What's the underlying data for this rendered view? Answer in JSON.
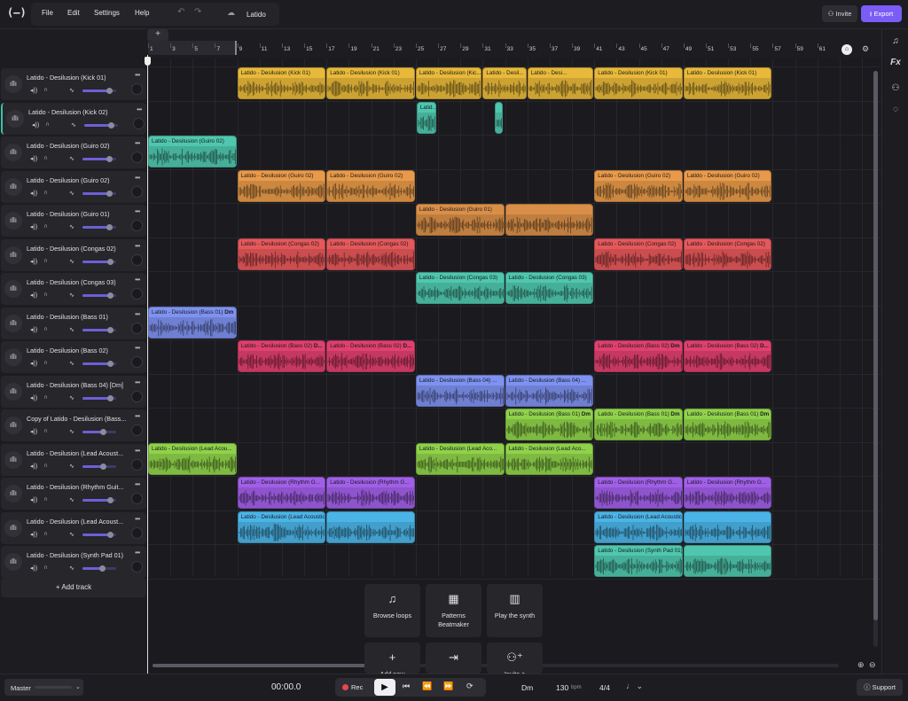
{
  "app": {
    "logo": "(—)",
    "project_name": "Latido"
  },
  "menu": {
    "items": [
      "File",
      "Edit",
      "Settings",
      "Help"
    ]
  },
  "header": {
    "invite_label": "Invite",
    "export_label": "Export"
  },
  "right_toolbar": {
    "icons": [
      "music-note-icon",
      "fx-icon",
      "users-icon",
      "chat-icon"
    ],
    "fx_label": "Fx"
  },
  "ruler": {
    "ticks": [
      "1",
      "3",
      "5",
      "7",
      "9",
      "11",
      "13",
      "15",
      "17",
      "19",
      "21",
      "23",
      "25",
      "27",
      "29",
      "31",
      "33",
      "35",
      "37",
      "39",
      "41",
      "43",
      "45",
      "47",
      "49",
      "51",
      "53",
      "55",
      "57",
      "59",
      "61"
    ]
  },
  "tracks": [
    {
      "name": "Latido - Desilusion (Kick 01)",
      "vol": 0.8
    },
    {
      "name": "Latido - Desilusion (Kick 02)",
      "vol": 0.8,
      "selected": true
    },
    {
      "name": "Latido - Desilusion (Guiro 02)",
      "vol": 0.78
    },
    {
      "name": "Latido - Desilusion (Guiro 02)",
      "vol": 0.78
    },
    {
      "name": "Latido - Desilusion (Guiro 01)",
      "vol": 0.78
    },
    {
      "name": "Latido - Desilusion (Congas 02)",
      "vol": 0.82
    },
    {
      "name": "Latido - Desilusion (Congas 03)",
      "vol": 0.82
    },
    {
      "name": "Latido - Desilusion (Bass 01)",
      "vol": 0.82
    },
    {
      "name": "Latido - Desilusion (Bass 02)",
      "vol": 0.82
    },
    {
      "name": "Latido - Desilusion (Bass 04) [Dm]",
      "vol": 0.82
    },
    {
      "name": "Copy of Latido - Desilusion (Bass...",
      "vol": 0.6
    },
    {
      "name": "Latido - Desilusion (Lead Acoust...",
      "vol": 0.6
    },
    {
      "name": "Latido - Desilusion (Rhythm Guit...",
      "vol": 0.82
    },
    {
      "name": "Latido - Desilusion (Lead Acoust...",
      "vol": 0.82
    },
    {
      "name": "Latido - Desilusion (Synth Pad 01)",
      "vol": 0.58
    }
  ],
  "track_controls": {
    "record_label": "R"
  },
  "add_track_label": "+ Add track",
  "clips": [
    {
      "row": 0,
      "label": "Latido - Desilusion (Kick 01)",
      "color": "#e8b93a"
    },
    {
      "row": 0,
      "label": "Latido - Desilusion (Kick 01)",
      "color": "#e8b93a"
    },
    {
      "row": 0,
      "label": "Latido - Desilusion (Kic...",
      "color": "#e8b93a"
    },
    {
      "row": 0,
      "label": "Latido - Desil...",
      "color": "#e8b93a"
    },
    {
      "row": 0,
      "label": "Latido - Desi...",
      "color": "#e8b93a"
    },
    {
      "row": 0,
      "label": "Latido - Desilusion (Kick 01)",
      "color": "#e8b93a"
    },
    {
      "row": 0,
      "label": "Latido - Desilusion (Kick 01)",
      "color": "#e8b93a"
    },
    {
      "row": 1,
      "label": "Latid...",
      "color": "#4fc7ae"
    },
    {
      "row": 1,
      "label": "",
      "color": "#4fc7ae"
    },
    {
      "row": 2,
      "label": "Latido - Desilusion (Guiro 02)",
      "color": "#4fc7ae"
    },
    {
      "row": 3,
      "label": "Latido - Desilusion (Guiro 02)",
      "color": "#e89a4a"
    },
    {
      "row": 3,
      "label": "Latido - Desilusion (Guiro 02)",
      "color": "#e89a4a"
    },
    {
      "row": 3,
      "label": "Latido - Desilusion (Guiro 02)",
      "color": "#e89a4a"
    },
    {
      "row": 3,
      "label": "Latido - Desilusion (Guiro 02)",
      "color": "#e89a4a"
    },
    {
      "row": 4,
      "label": "Latido - Desilusion (Guiro 01)",
      "color": "#d98f48"
    },
    {
      "row": 4,
      "label": "",
      "color": "#d98f48"
    },
    {
      "row": 5,
      "label": "Latido - Desilusion (Congas 02)",
      "color": "#e5585a"
    },
    {
      "row": 5,
      "label": "Latido - Desilusion (Congas 02)",
      "color": "#e5585a"
    },
    {
      "row": 5,
      "label": "Latido - Desilusion (Congas 02)",
      "color": "#e5585a"
    },
    {
      "row": 5,
      "label": "Latido - Desilusion (Congas 02)",
      "color": "#e5585a"
    },
    {
      "row": 6,
      "label": "Latido - Desilusion (Congas 03)",
      "color": "#4fc7ae"
    },
    {
      "row": 6,
      "label": "Latido - Desilusion (Congas 03)",
      "color": "#4fc7ae"
    },
    {
      "row": 7,
      "label": "Latido - Desilusion (Bass 01)",
      "tag": "Dm",
      "color": "#7e92f0"
    },
    {
      "row": 8,
      "label": "Latido - Desilusion (Bass 02)",
      "tag": "D...",
      "color": "#e0406f"
    },
    {
      "row": 8,
      "label": "Latido - Desilusion (Bass 02)",
      "tag": "D...",
      "color": "#e0406f"
    },
    {
      "row": 8,
      "label": "Latido - Desilusion (Bass 02)",
      "tag": "Dm",
      "color": "#e0406f"
    },
    {
      "row": 8,
      "label": "Latido - Desilusion (Bass 02)",
      "tag": "D...",
      "color": "#e0406f"
    },
    {
      "row": 9,
      "label": "Latido - Desilusion (Bass 04) ...",
      "color": "#7e92f0"
    },
    {
      "row": 9,
      "label": "Latido - Desilusion (Bass 04) ...",
      "color": "#7e92f0"
    },
    {
      "row": 10,
      "label": "Latido - Desilusion (Bass 01)",
      "tag": "Dm",
      "color": "#8fd24a"
    },
    {
      "row": 10,
      "label": "Latido - Desilusion (Bass 01)",
      "tag": "Dm",
      "color": "#8fd24a"
    },
    {
      "row": 10,
      "label": "Latido - Desilusion (Bass 01)",
      "tag": "Dm",
      "color": "#8fd24a"
    },
    {
      "row": 11,
      "label": "Latido - Desilusion (Lead Acou...",
      "color": "#8fd24a"
    },
    {
      "row": 11,
      "label": "Latido - Desilusion (Lead Aco...",
      "color": "#8fd24a"
    },
    {
      "row": 11,
      "label": "Latido - Desilusion (Lead Aco...",
      "color": "#8fd24a"
    },
    {
      "row": 11,
      "label": "Latido - Desilusion (Lead Aco...",
      "color": "#8fd24a"
    },
    {
      "row": 12,
      "label": "Latido - Desilusion (Rhythm G...",
      "color": "#a15fe8"
    },
    {
      "row": 12,
      "label": "Latido - Desilusion (Rhythm G...",
      "color": "#a15fe8"
    },
    {
      "row": 12,
      "label": "Latido - Desilusion (Rhythm G...",
      "color": "#a15fe8"
    },
    {
      "row": 12,
      "label": "Latido - Desilusion (Rhythm G...",
      "color": "#a15fe8"
    },
    {
      "row": 13,
      "label": "Latido - Desilusion (Lead Acoustic Guitar 02)",
      "tag": "Dm",
      "color": "#4bb4e6"
    },
    {
      "row": 13,
      "label": "",
      "color": "#4bb4e6"
    },
    {
      "row": 13,
      "label": "Latido - Desilusion (Lead Acoustic Guitar 02)",
      "tag": "Dm",
      "color": "#4bb4e6"
    },
    {
      "row": 13,
      "label": "",
      "color": "#4bb4e6"
    },
    {
      "row": 14,
      "label": "Latido - Desilusion (Synth Pad 01)",
      "tag": "Dm",
      "color": "#4fc7ae"
    },
    {
      "row": 14,
      "label": "",
      "color": "#4fc7ae"
    }
  ],
  "quick_actions": [
    {
      "label": "Browse loops",
      "icon": "music-note-icon"
    },
    {
      "label": "Patterns Beatmaker",
      "icon": "grid-icon"
    },
    {
      "label": "Play the synth",
      "icon": "piano-icon"
    },
    {
      "label": "Add new",
      "icon": "plus-icon"
    },
    {
      "label": "",
      "icon": "import-icon"
    },
    {
      "label": "Invite a",
      "icon": "add-user-icon"
    }
  ],
  "transport": {
    "master_label": "Master",
    "time": "00:00.0",
    "rec_label": "Rec",
    "key": "Dm",
    "bpm": "130",
    "bpm_unit": "bpm",
    "time_signature": "4/4",
    "support_label": "Support"
  }
}
